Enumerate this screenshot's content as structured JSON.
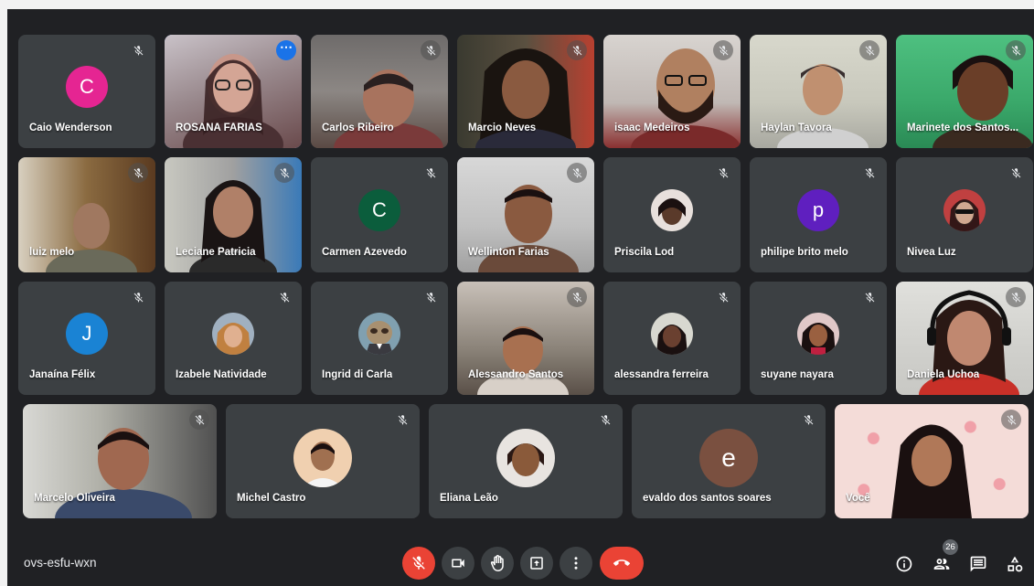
{
  "meeting": {
    "code": "ovs-esfu-wxn",
    "participant_count": "26"
  },
  "participants": {
    "caio": {
      "name": "Caio Wenderson",
      "initial": "C",
      "color": "#e52592"
    },
    "rosana": {
      "name": "ROSANA FARIAS"
    },
    "carlos": {
      "name": "Carlos Ribeiro"
    },
    "marcio": {
      "name": "Marcio Neves"
    },
    "isaac": {
      "name": "isaac Medeiros"
    },
    "haylan": {
      "name": "Haylan Tavora"
    },
    "marinete": {
      "name": "Marinete dos Santos..."
    },
    "luiz": {
      "name": "luiz melo"
    },
    "leciane": {
      "name": "Leciane Patricia"
    },
    "carmen": {
      "name": "Carmen Azevedo",
      "initial": "C",
      "color": "#0b5d3c"
    },
    "wellinton": {
      "name": "Wellinton Farias"
    },
    "priscila": {
      "name": "Priscila Lod"
    },
    "philipe": {
      "name": "philipe brito melo",
      "initial": "p",
      "color": "#5f1fbf"
    },
    "nivea": {
      "name": "Nivea Luz"
    },
    "janaina": {
      "name": "Janaína Félix",
      "initial": "J",
      "color": "#1a83d4"
    },
    "izabele": {
      "name": "Izabele Natividade"
    },
    "ingrid": {
      "name": "Ingrid di Carla"
    },
    "alessandro": {
      "name": "Alessandro Santos"
    },
    "alessandra": {
      "name": "alessandra ferreira"
    },
    "suyane": {
      "name": "suyane nayara"
    },
    "daniela": {
      "name": "Daniela Uchoa"
    },
    "marcelo": {
      "name": "Marcelo Oliveira"
    },
    "michel": {
      "name": "Michel Castro"
    },
    "eliana": {
      "name": "Eliana Leão"
    },
    "evaldo": {
      "name": "evaldo dos santos soares",
      "initial": "e",
      "color": "#7a5040"
    },
    "voce": {
      "name": "Você"
    }
  },
  "controls": {
    "mic": "mic-off-icon",
    "camera": "camera-icon",
    "raise_hand": "hand-icon",
    "present": "present-screen-icon",
    "more": "more-options-icon",
    "leave": "end-call-icon"
  },
  "colors": {
    "background": "#202124",
    "tile": "#3c4043",
    "danger": "#ea4335",
    "accent": "#8ab4f8"
  }
}
